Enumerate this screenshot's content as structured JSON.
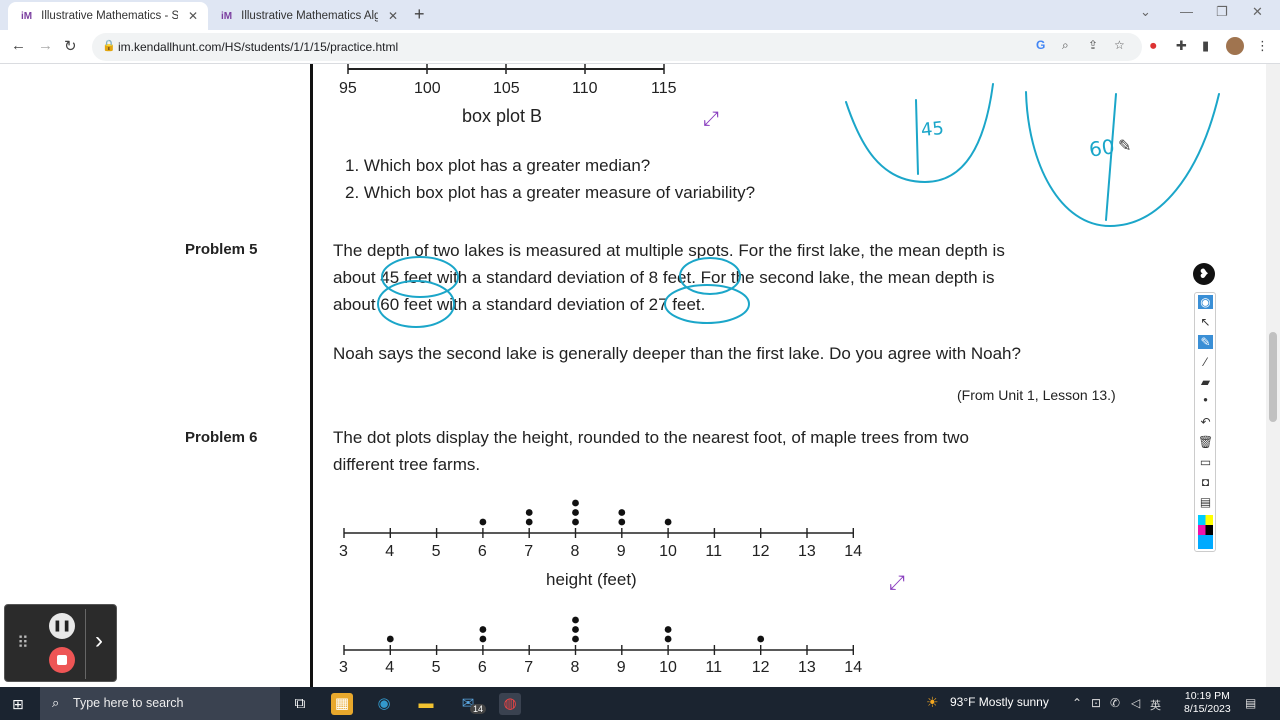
{
  "browser": {
    "tabs": [
      {
        "title": "Illustrative Mathematics - Studen",
        "active": true
      },
      {
        "title": "Illustrative Mathematics Algebra",
        "active": false
      }
    ],
    "url": "im.kendallhunt.com/HS/students/1/1/15/practice.html"
  },
  "page": {
    "box_plot_b": {
      "ticks": [
        "95",
        "100",
        "105",
        "110",
        "115"
      ],
      "label": "box plot B"
    },
    "questions": [
      "1. Which box plot has a greater median?",
      "2. Which box plot has a greater measure of variability?"
    ],
    "problem5": {
      "heading": "Problem 5",
      "line1": "The depth of two lakes is measured at multiple spots. For the first lake, the mean depth is",
      "line2": "about 45 feet with a standard deviation of 8 feet. For the second lake, the mean depth is",
      "line3": "about 60 feet with a standard deviation of 27 feet.",
      "line4": "Noah says the second lake is generally deeper than the first lake. Do you agree with Noah?",
      "source": "(From Unit 1, Lesson 13.)"
    },
    "problem6": {
      "heading": "Problem 6",
      "line1": "The dot plots display the height, rounded to the nearest foot, of maple trees from two",
      "line2": "different tree farms.",
      "axis_label": "height (feet)",
      "ticks": [
        "3",
        "4",
        "5",
        "6",
        "7",
        "8",
        "9",
        "10",
        "11",
        "12",
        "13",
        "14"
      ]
    },
    "handwriting": {
      "left": "45",
      "right": "60"
    }
  },
  "chart_data": [
    {
      "type": "scatter",
      "title": "",
      "xlabel": "height (feet)",
      "xlim": [
        3,
        14
      ],
      "dots": {
        "6": 1,
        "7": 2,
        "8": 3,
        "9": 2,
        "10": 1
      }
    },
    {
      "type": "scatter",
      "title": "",
      "xlabel": "",
      "xlim": [
        3,
        14
      ],
      "dots": {
        "4": 1,
        "6": 2,
        "8": 3,
        "10": 2,
        "12": 1
      }
    }
  ],
  "taskbar": {
    "search_placeholder": "Type here to search",
    "weather": "93°F  Mostly sunny",
    "time": "10:19 PM",
    "date": "8/15/2023",
    "mail_badge": "14"
  }
}
